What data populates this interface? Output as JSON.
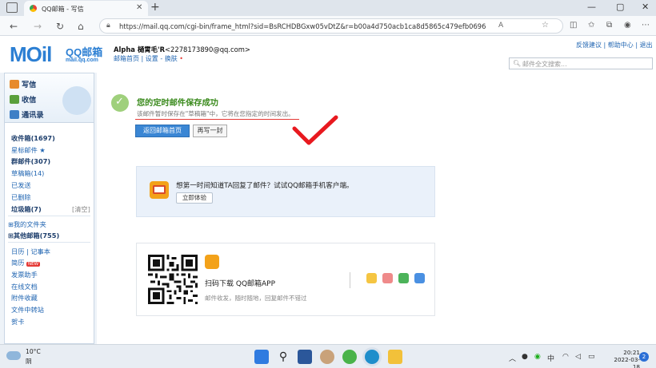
{
  "browser": {
    "tab_title": "QQ邮箱 - 写信",
    "tab_close": "✕",
    "new_tab": "+",
    "url": "https://mail.qq.com/cgi-bin/frame_html?sid=BsRCHDBGxw05vDtZ&r=b00a4d750acb1ca8d5865c479efb0696",
    "read_aloud": "A",
    "window_controls": [
      "—",
      "▢",
      "✕"
    ]
  },
  "header": {
    "logo_text": "MOil",
    "logo_cn": "QQ邮箱",
    "logo_domain": "mail.qq.com",
    "user_name": "Alpha 樋霄毛'R",
    "user_email": "<2278173890@qq.com>",
    "user_links": "邮箱首页 | 设置 - 换肤",
    "top_links": "反馈建议 | 帮助中心 | 退出",
    "search_placeholder": "邮件全文搜索..."
  },
  "sidebar": {
    "compose": "写信",
    "inbox_btn": "收信",
    "contacts": "通讯录",
    "folders": [
      {
        "label": "收件箱(1697)",
        "bold": true
      },
      {
        "label": "星标邮件 ★",
        "bold": false
      },
      {
        "label": "群邮件(307)",
        "bold": true
      },
      {
        "label": "草稿箱(14)",
        "bold": false
      },
      {
        "label": "已发送",
        "bold": false
      },
      {
        "label": "已删除",
        "bold": false
      },
      {
        "label": "垃圾箱(7)",
        "bold": true
      }
    ],
    "clear_label": "[清空]",
    "my_folders": "⊞我的文件夹",
    "other_mailbox": "⊞其他邮箱(755)",
    "tools": [
      {
        "label": "日历 | 记事本"
      },
      {
        "label": "简历",
        "badge": "NEW"
      },
      {
        "label": "发票助手"
      },
      {
        "label": "在线文档"
      },
      {
        "label": "附件收藏"
      },
      {
        "label": "文件中转站"
      },
      {
        "label": "贺卡"
      }
    ]
  },
  "main": {
    "success_title": "您的定时邮件保存成功",
    "success_subtitle": "该邮件暂时保存在\"草稿箱\"中，它将在您指定的时间发出。",
    "back_button": "返回邮箱首页",
    "write_again_button": "再写一封",
    "promo_text": "想第一时间知道TA回复了邮件？试试QQ邮箱手机客户端。",
    "promo_button": "立即体验",
    "app_title": "扫码下载 QQ邮箱APP",
    "app_subtitle": "邮件收发，随时随地，回复邮件不错过"
  },
  "taskbar": {
    "temperature": "10°C",
    "weather": "阴",
    "time": "20:21",
    "date": "2022-03-18",
    "notifications": "2"
  },
  "colors": {
    "accent_blue": "#2c7fd3",
    "success_green": "#3a8a1c",
    "annotation_red": "#e53935",
    "primary_button": "#3a86d4"
  }
}
